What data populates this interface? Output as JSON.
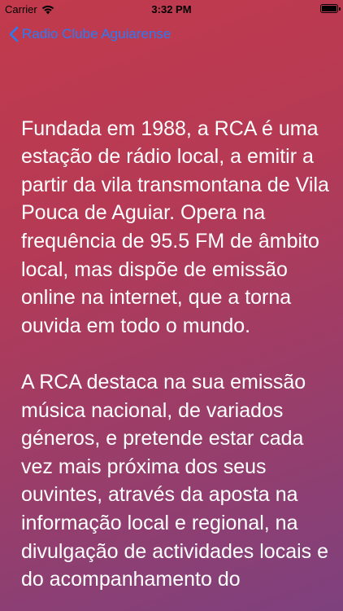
{
  "status_bar": {
    "carrier": "Carrier",
    "time": "3:32 PM",
    "wifi_icon": "wifi-icon",
    "battery_icon": "battery-icon"
  },
  "nav": {
    "back_icon": "chevron-left-icon",
    "back_label": "Radio Clube Aguiarense"
  },
  "content": {
    "paragraph_1": "Fundada em 1988, a RCA é uma estação de rádio local, a emitir a partir da vila transmontana de Vila Pouca de Aguiar. Opera na frequência de 95.5 FM de âmbito local, mas dispõe de emissão online na internet, que a torna ouvida em todo o mundo.",
    "paragraph_2": "A RCA destaca na sua emissão música nacional, de variados géneros, e pretende estar cada vez mais próxima dos seus ouvintes, através da aposta na informação local e regional, na divulgação de actividades locais e do acompanhamento do"
  },
  "colors": {
    "accent": "#2a7cf6",
    "gradient_top": "#c23a4c",
    "gradient_bottom": "#7e417e",
    "text": "#ffffff"
  }
}
